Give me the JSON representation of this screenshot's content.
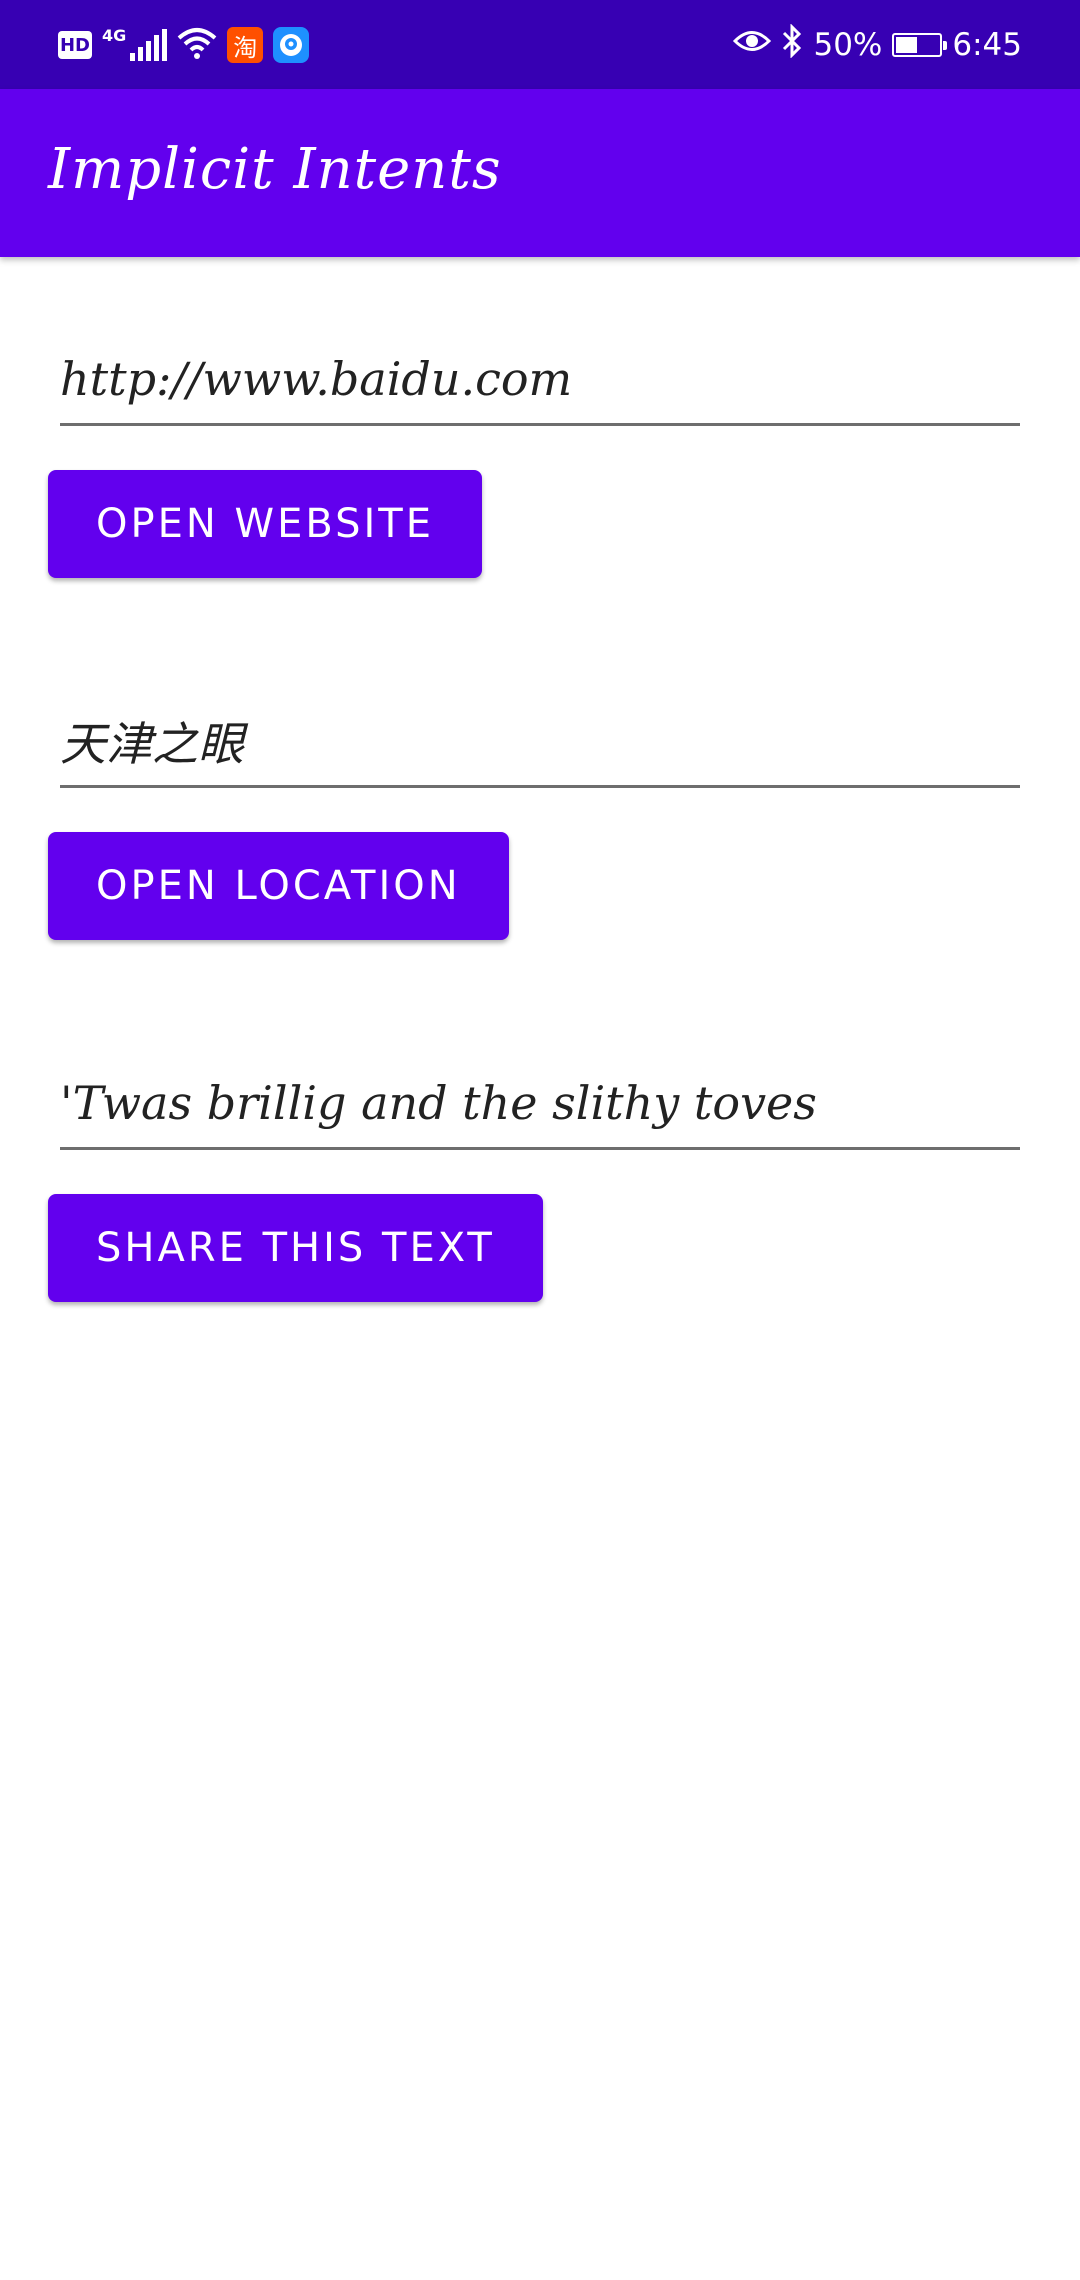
{
  "status_bar": {
    "hd_label": "HD",
    "network_type": "4G",
    "taobao_label": "淘",
    "battery_percent": "50%",
    "battery_level": 0.5,
    "time": "6:45",
    "icons": [
      "hd-icon",
      "signal-icon",
      "wifi-icon",
      "taobao-app-icon",
      "notification-app-icon",
      "eye-icon",
      "bluetooth-icon",
      "battery-charging-icon"
    ]
  },
  "app_bar": {
    "title": "Implicit Intents",
    "background": "#6200ee"
  },
  "colors": {
    "status_bar": "#3700b3",
    "accent": "#6200ee",
    "button_text": "#ffffff"
  },
  "website": {
    "input_value": "http://www.baidu.com",
    "button_label": "OPEN WEBSITE"
  },
  "location": {
    "input_value": "天津之眼",
    "button_label": "OPEN LOCATION"
  },
  "share": {
    "input_value": "'Twas brillig and the slithy toves",
    "button_label": "SHARE THIS TEXT"
  }
}
